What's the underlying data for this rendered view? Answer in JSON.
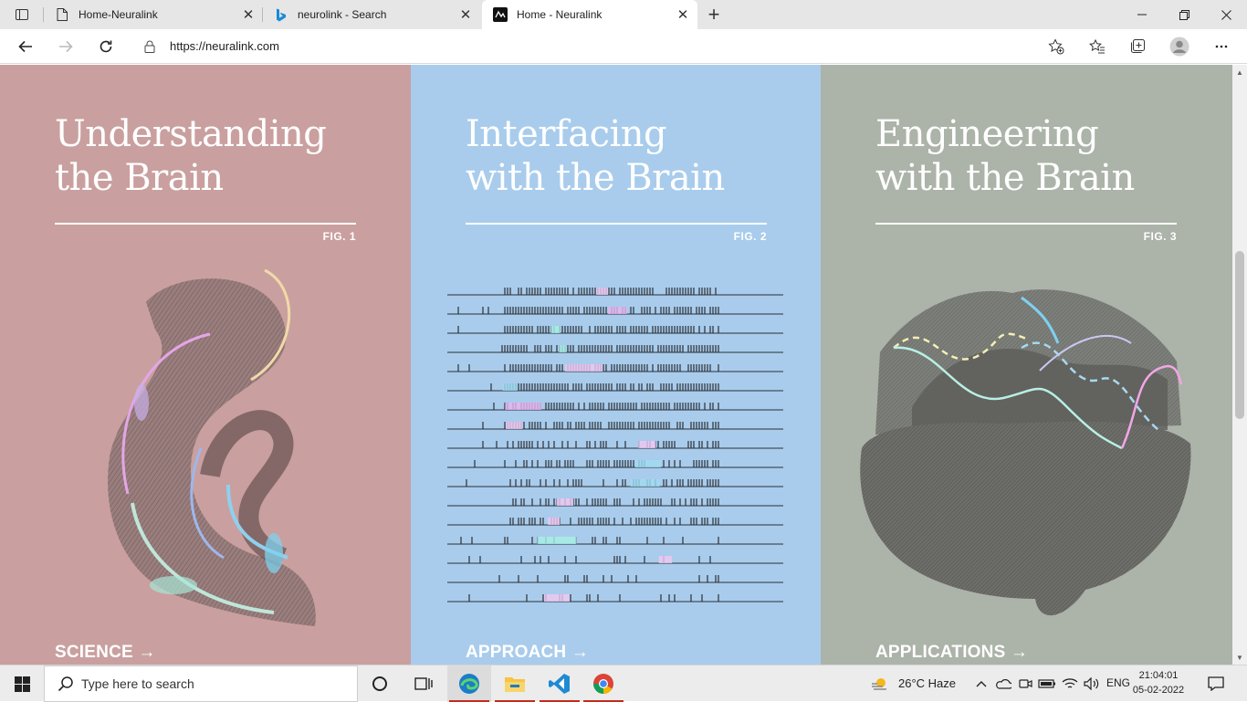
{
  "browser": {
    "tabs": [
      {
        "title": "Home-Neuralink",
        "favicon": "page-icon",
        "active": false
      },
      {
        "title": "neurolink - Search",
        "favicon": "bing-icon",
        "active": false
      },
      {
        "title": "Home - Neuralink",
        "favicon": "neuralink-icon",
        "active": true
      }
    ],
    "url": "https://neuralink.com"
  },
  "panels": [
    {
      "title_line1": "Understanding",
      "title_line2": "the Brain",
      "fig": "FIG. 1",
      "link": "SCIENCE →",
      "bg": "#c9a09f"
    },
    {
      "title_line1": "Interfacing",
      "title_line2": "with the Brain",
      "fig": "FIG. 2",
      "link": "APPROACH →",
      "bg": "#a9ccec"
    },
    {
      "title_line1": "Engineering",
      "title_line2": "with the Brain",
      "fig": "FIG. 3",
      "link": "APPLICATIONS →",
      "bg": "#acb3a9"
    }
  ],
  "taskbar": {
    "search_placeholder": "Type here to search",
    "weather": "26°C  Haze",
    "language": "ENG",
    "time": "21:04:01",
    "date": "05-02-2022",
    "pinned": [
      "task-view-icon",
      "widgets-icon",
      "edge-icon",
      "file-explorer-icon",
      "vscode-icon",
      "chrome-icon"
    ]
  }
}
